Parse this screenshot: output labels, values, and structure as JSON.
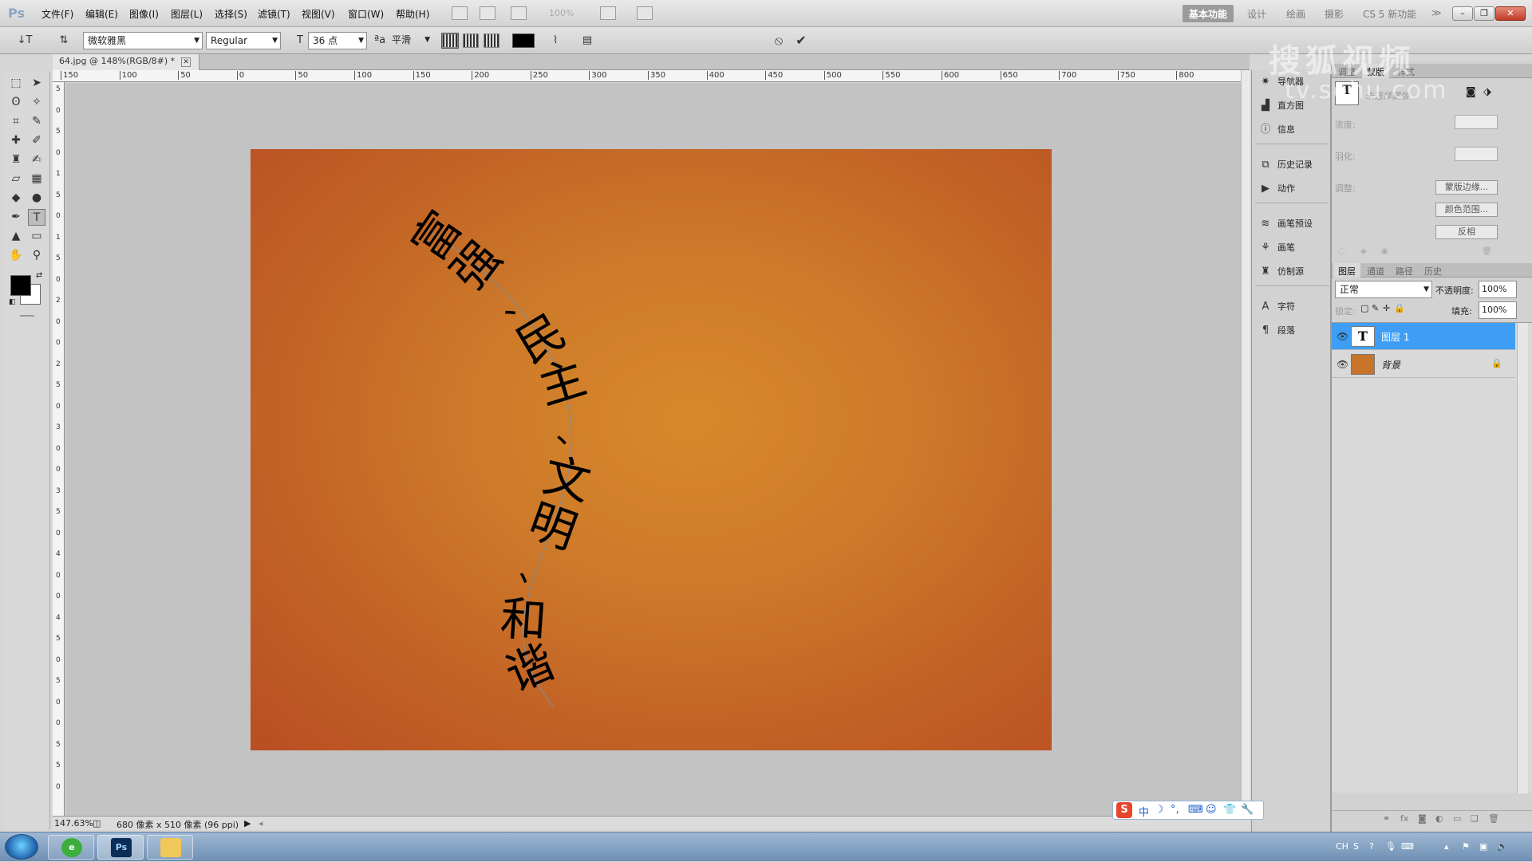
{
  "app": {
    "logo": "Ps"
  },
  "menu": {
    "items": [
      "文件(F)",
      "编辑(E)",
      "图像(I)",
      "图层(L)",
      "选择(S)",
      "滤镜(T)",
      "视图(V)",
      "窗口(W)",
      "帮助(H)"
    ],
    "zoom": "100%",
    "workspaces": [
      "基本功能",
      "设计",
      "绘画",
      "摄影",
      "CS 5 新功能"
    ],
    "more": "≫"
  },
  "options": {
    "font_family": "微软雅黑",
    "font_style": "Regular",
    "font_size": "36 点",
    "aa_label": "aa",
    "antialias": "平滑",
    "text_color": "#000000"
  },
  "document": {
    "tab_title": "64.jpg @ 148%(RGB/8#) *",
    "zoom_status": "147.63%",
    "doc_info": "680 像素 x 510 像素 (96 ppi)",
    "ruler_h": [
      "150",
      "100",
      "50",
      "0",
      "50",
      "100",
      "150",
      "200",
      "250",
      "300",
      "350",
      "400",
      "450",
      "500",
      "550",
      "600",
      "650",
      "700",
      "750",
      "800"
    ],
    "ruler_v": [
      "5",
      "0",
      "5",
      "0",
      "1",
      "5",
      "0",
      "1",
      "5",
      "0",
      "2",
      "0",
      "0",
      "2",
      "5",
      "0",
      "3",
      "0",
      "0",
      "3",
      "5",
      "0",
      "4",
      "0",
      "0",
      "4",
      "5",
      "0",
      "5",
      "0",
      "0",
      "5",
      "5",
      "0"
    ]
  },
  "canvas_text": {
    "glyphs": [
      "富",
      "强",
      "、",
      "民",
      "主",
      "、",
      "文",
      "明",
      "、",
      "和",
      "谐"
    ]
  },
  "panel_strip": {
    "items": [
      "导航器",
      "直方图",
      "信息",
      "历史记录",
      "动作",
      "画笔预设",
      "画笔",
      "仿制源",
      "字符",
      "段落"
    ]
  },
  "masks_panel": {
    "tabs": [
      "调整",
      "蒙版",
      "样式"
    ],
    "hint": "未选择蒙版",
    "density_label": "浓度:",
    "feather_label": "羽化:",
    "refine_label": "调整:",
    "buttons": [
      "蒙版边缘...",
      "颜色范围...",
      "反相"
    ]
  },
  "layers_panel": {
    "tabs": [
      "图层",
      "通道",
      "路径",
      "历史"
    ],
    "blend_mode": "正常",
    "opacity_label": "不透明度:",
    "opacity": "100%",
    "lock_label": "锁定:",
    "fill_label": "填充:",
    "fill": "100%",
    "layers": [
      {
        "name": "图层 1",
        "type": "text",
        "selected": true
      },
      {
        "name": "背景",
        "type": "image",
        "selected": false,
        "locked": true
      }
    ]
  },
  "ime": {
    "label": "中"
  },
  "tray": {
    "lang": "CH"
  },
  "watermark": {
    "line1": "搜狐视频",
    "line2": "tv.sohu.com"
  }
}
